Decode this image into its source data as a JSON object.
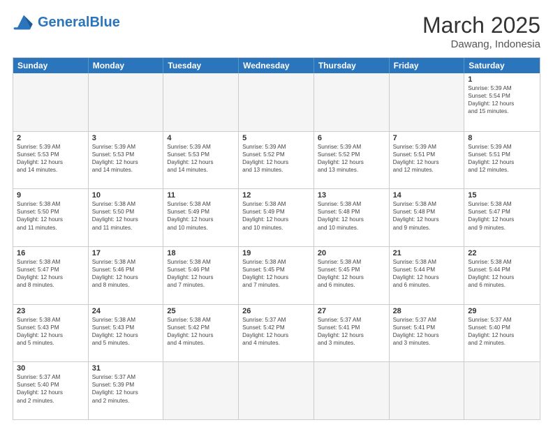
{
  "header": {
    "logo_general": "General",
    "logo_blue": "Blue",
    "month_year": "March 2025",
    "location": "Dawang, Indonesia"
  },
  "weekdays": [
    "Sunday",
    "Monday",
    "Tuesday",
    "Wednesday",
    "Thursday",
    "Friday",
    "Saturday"
  ],
  "rows": [
    [
      {
        "day": "",
        "info": ""
      },
      {
        "day": "",
        "info": ""
      },
      {
        "day": "",
        "info": ""
      },
      {
        "day": "",
        "info": ""
      },
      {
        "day": "",
        "info": ""
      },
      {
        "day": "",
        "info": ""
      },
      {
        "day": "1",
        "info": "Sunrise: 5:39 AM\nSunset: 5:54 PM\nDaylight: 12 hours\nand 15 minutes."
      }
    ],
    [
      {
        "day": "2",
        "info": "Sunrise: 5:39 AM\nSunset: 5:53 PM\nDaylight: 12 hours\nand 14 minutes."
      },
      {
        "day": "3",
        "info": "Sunrise: 5:39 AM\nSunset: 5:53 PM\nDaylight: 12 hours\nand 14 minutes."
      },
      {
        "day": "4",
        "info": "Sunrise: 5:39 AM\nSunset: 5:53 PM\nDaylight: 12 hours\nand 14 minutes."
      },
      {
        "day": "5",
        "info": "Sunrise: 5:39 AM\nSunset: 5:52 PM\nDaylight: 12 hours\nand 13 minutes."
      },
      {
        "day": "6",
        "info": "Sunrise: 5:39 AM\nSunset: 5:52 PM\nDaylight: 12 hours\nand 13 minutes."
      },
      {
        "day": "7",
        "info": "Sunrise: 5:39 AM\nSunset: 5:51 PM\nDaylight: 12 hours\nand 12 minutes."
      },
      {
        "day": "8",
        "info": "Sunrise: 5:39 AM\nSunset: 5:51 PM\nDaylight: 12 hours\nand 12 minutes."
      }
    ],
    [
      {
        "day": "9",
        "info": "Sunrise: 5:38 AM\nSunset: 5:50 PM\nDaylight: 12 hours\nand 11 minutes."
      },
      {
        "day": "10",
        "info": "Sunrise: 5:38 AM\nSunset: 5:50 PM\nDaylight: 12 hours\nand 11 minutes."
      },
      {
        "day": "11",
        "info": "Sunrise: 5:38 AM\nSunset: 5:49 PM\nDaylight: 12 hours\nand 10 minutes."
      },
      {
        "day": "12",
        "info": "Sunrise: 5:38 AM\nSunset: 5:49 PM\nDaylight: 12 hours\nand 10 minutes."
      },
      {
        "day": "13",
        "info": "Sunrise: 5:38 AM\nSunset: 5:48 PM\nDaylight: 12 hours\nand 10 minutes."
      },
      {
        "day": "14",
        "info": "Sunrise: 5:38 AM\nSunset: 5:48 PM\nDaylight: 12 hours\nand 9 minutes."
      },
      {
        "day": "15",
        "info": "Sunrise: 5:38 AM\nSunset: 5:47 PM\nDaylight: 12 hours\nand 9 minutes."
      }
    ],
    [
      {
        "day": "16",
        "info": "Sunrise: 5:38 AM\nSunset: 5:47 PM\nDaylight: 12 hours\nand 8 minutes."
      },
      {
        "day": "17",
        "info": "Sunrise: 5:38 AM\nSunset: 5:46 PM\nDaylight: 12 hours\nand 8 minutes."
      },
      {
        "day": "18",
        "info": "Sunrise: 5:38 AM\nSunset: 5:46 PM\nDaylight: 12 hours\nand 7 minutes."
      },
      {
        "day": "19",
        "info": "Sunrise: 5:38 AM\nSunset: 5:45 PM\nDaylight: 12 hours\nand 7 minutes."
      },
      {
        "day": "20",
        "info": "Sunrise: 5:38 AM\nSunset: 5:45 PM\nDaylight: 12 hours\nand 6 minutes."
      },
      {
        "day": "21",
        "info": "Sunrise: 5:38 AM\nSunset: 5:44 PM\nDaylight: 12 hours\nand 6 minutes."
      },
      {
        "day": "22",
        "info": "Sunrise: 5:38 AM\nSunset: 5:44 PM\nDaylight: 12 hours\nand 6 minutes."
      }
    ],
    [
      {
        "day": "23",
        "info": "Sunrise: 5:38 AM\nSunset: 5:43 PM\nDaylight: 12 hours\nand 5 minutes."
      },
      {
        "day": "24",
        "info": "Sunrise: 5:38 AM\nSunset: 5:43 PM\nDaylight: 12 hours\nand 5 minutes."
      },
      {
        "day": "25",
        "info": "Sunrise: 5:38 AM\nSunset: 5:42 PM\nDaylight: 12 hours\nand 4 minutes."
      },
      {
        "day": "26",
        "info": "Sunrise: 5:37 AM\nSunset: 5:42 PM\nDaylight: 12 hours\nand 4 minutes."
      },
      {
        "day": "27",
        "info": "Sunrise: 5:37 AM\nSunset: 5:41 PM\nDaylight: 12 hours\nand 3 minutes."
      },
      {
        "day": "28",
        "info": "Sunrise: 5:37 AM\nSunset: 5:41 PM\nDaylight: 12 hours\nand 3 minutes."
      },
      {
        "day": "29",
        "info": "Sunrise: 5:37 AM\nSunset: 5:40 PM\nDaylight: 12 hours\nand 2 minutes."
      }
    ],
    [
      {
        "day": "30",
        "info": "Sunrise: 5:37 AM\nSunset: 5:40 PM\nDaylight: 12 hours\nand 2 minutes."
      },
      {
        "day": "31",
        "info": "Sunrise: 5:37 AM\nSunset: 5:39 PM\nDaylight: 12 hours\nand 2 minutes."
      },
      {
        "day": "",
        "info": ""
      },
      {
        "day": "",
        "info": ""
      },
      {
        "day": "",
        "info": ""
      },
      {
        "day": "",
        "info": ""
      },
      {
        "day": "",
        "info": ""
      }
    ]
  ]
}
